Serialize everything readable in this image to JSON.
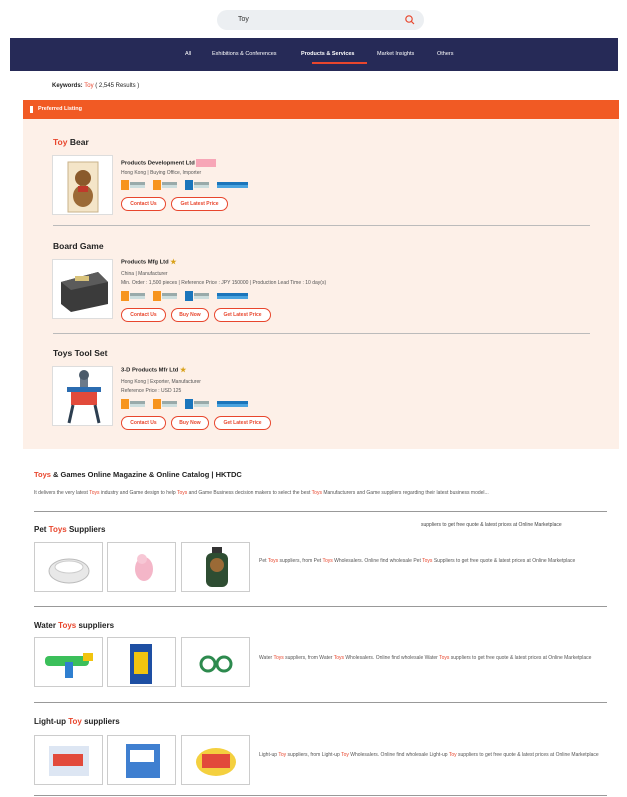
{
  "search": {
    "query": "Toy"
  },
  "nav": {
    "items": [
      "All",
      "Exhibitions & Conferences",
      "Products & Services",
      "Market Insights",
      "Others"
    ],
    "active": "Products & Services"
  },
  "keywords": {
    "label": "Keywords:",
    "term": "Toy",
    "count": "( 2,545 Results )"
  },
  "preferred_listing": "Preferred Listing",
  "products": [
    {
      "title_highlight": "Toy",
      "title_rest": " Bear",
      "company": "Products Development Ltd",
      "meta": [
        "Hong Kong  |  Buying Office, Importer"
      ],
      "buttons": [
        "Contact Us",
        "Get Latest Price"
      ]
    },
    {
      "title_highlight": "",
      "title_rest": "Board Game",
      "company": "Products Mfg Ltd",
      "meta": [
        "China  |  Manufacturer",
        "Min. Order : 1,500 pieces  |  Reference Price : JPY 150000  |  Production Lead Time : 10 day(s)"
      ],
      "buttons": [
        "Contact Us",
        "Buy Now",
        "Get Latest Price"
      ]
    },
    {
      "title_highlight": "",
      "title_rest": "Toys Tool Set",
      "company": "3-D Products Mfr Ltd",
      "meta": [
        "Hong Kong  |  Exporter, Manufacturer",
        "Reference Price : USD 125"
      ],
      "buttons": [
        "Contact Us",
        "Buy Now",
        "Get Latest Price"
      ]
    }
  ],
  "magazine": {
    "title_highlight": "Toys",
    "title_rest": " & Games Online Magazine & Online Catalog | HKTDC",
    "desc_parts": [
      "It delivers the very latest ",
      "Toys",
      " industry and Game design to help ",
      "Toys",
      " and Game Business decision makers to select the best ",
      "Toys",
      " Manufacturers and Game suppliers regarding their latest business model..."
    ]
  },
  "sections": [
    {
      "title_a": "Pet ",
      "title_h": "Toys",
      "title_b": " Suppliers",
      "note": "suppliers to get free quote & latest prices at Online Marketplace",
      "desc_parts": [
        "Pet ",
        "Toys",
        " suppliers, from Pet ",
        "Toys",
        " Wholesalers. Online find wholesale Pet ",
        "Toys",
        " Suppliers to get free quote & latest prices at Online Marketplace"
      ]
    },
    {
      "title_a": "Water ",
      "title_h": "Toys",
      "title_b": " suppliers",
      "note": "",
      "desc_parts": [
        "Water ",
        "Toys",
        " suppliers, from Water ",
        "Toys",
        " Wholesalers. Online find wholesale Water ",
        "Toys",
        " suppliers to get free quote & latest prices at Online Marketplace"
      ]
    },
    {
      "title_a": "Light-up ",
      "title_h": "Toy",
      "title_b": " suppliers",
      "note": "",
      "desc_parts": [
        "Light-up ",
        "Toy",
        " suppliers, from Light-up ",
        "Toy",
        " Wholesalers. Online find wholesale Light-up ",
        "Toy",
        " suppliers to get free quote & latest prices at Online Marketplace"
      ]
    }
  ],
  "colors": {
    "accent": "#e8462d",
    "nav": "#262a57",
    "panel": "#fdf0e8",
    "banner": "#f15a24"
  }
}
